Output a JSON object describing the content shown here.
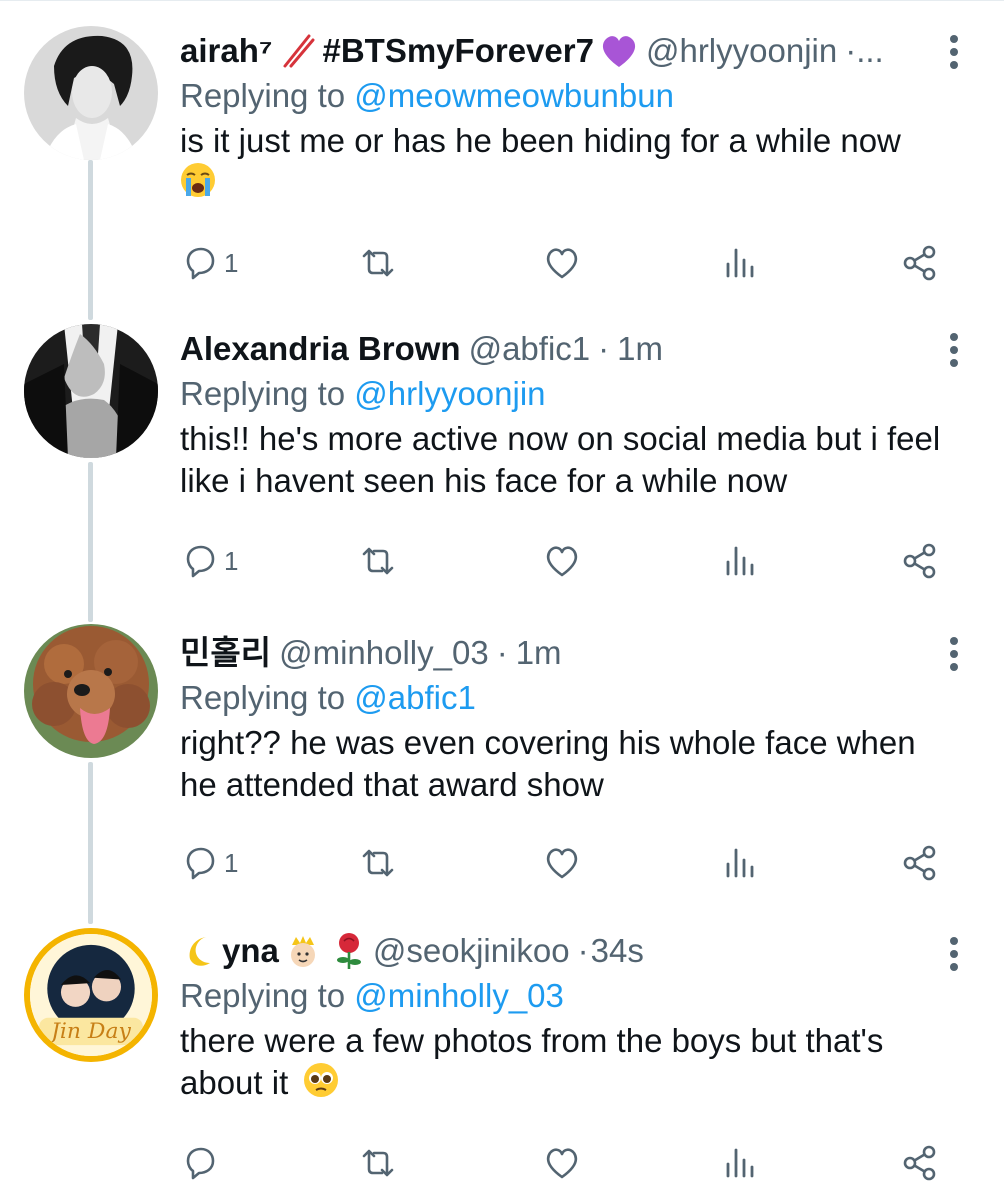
{
  "tweets": [
    {
      "display_name": "airah⁷",
      "badge_text": "#BTSmyForever7",
      "handle": "@hrlyyoonjin",
      "time": "·...",
      "replying_prefix": "Replying to",
      "replying_to": "@meowmeowbunbun",
      "body": "is it just me or has he been hiding for a while now",
      "trailing_emoji": "crying-face",
      "reply_count": "1"
    },
    {
      "display_name": "Alexandria Brown",
      "handle": "@abfic1",
      "dot": "·",
      "time": "1m",
      "replying_prefix": "Replying to",
      "replying_to": "@hrlyyoonjin",
      "body": "this!! he's more active now on social media but i feel like i havent seen his face for a while now",
      "reply_count": "1"
    },
    {
      "display_name": "민홀리",
      "handle": "@minholly_03",
      "dot": "·",
      "time": "1m",
      "replying_prefix": "Replying to",
      "replying_to": "@abfic1",
      "body": "right?? he was even covering his whole face when he attended that award show",
      "reply_count": "1"
    },
    {
      "display_name": "yna",
      "handle": "@seokjinikoo",
      "dot": "·",
      "time": "34s",
      "replying_prefix": "Replying to",
      "replying_to": "@minholly_03",
      "body": "there were a few photos from the boys but that's about it",
      "trailing_emoji": "pleading-face",
      "reply_count": "",
      "avatar_text": "Jin Day"
    }
  ],
  "colors": {
    "text": "#0f1419",
    "secondary": "#536471",
    "link": "#1d9bf0",
    "thread_line": "#cfd9de",
    "purple_heart": "#a855d6",
    "chopsticks": "#d6333b"
  }
}
